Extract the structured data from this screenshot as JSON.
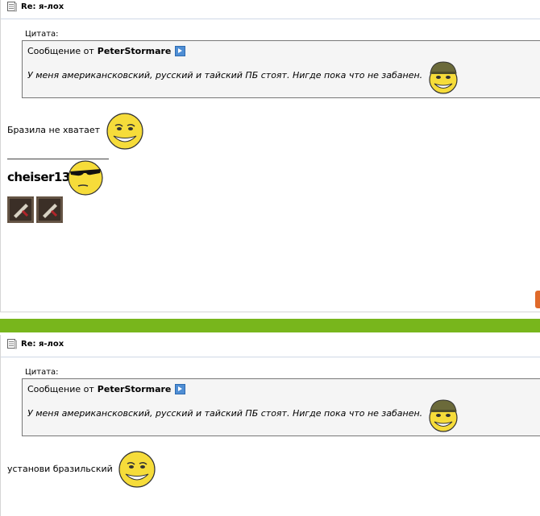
{
  "posts": [
    {
      "title": "Re: я-лох",
      "quote_label": "Цитата:",
      "quote_author_prefix": "Сообщение от",
      "quote_author": "PeterStormare",
      "quote_text": "У меня американскoвский, русский и тайский ПБ стоят. Нигде пока что не забанен.",
      "message": "Бразила не хватает",
      "signature": "cheiser13"
    },
    {
      "title": "Re: я-лох",
      "quote_label": "Цитата:",
      "quote_author_prefix": "Сообщение от",
      "quote_author": "PeterStormare",
      "quote_text": "У меня американскoвский, русский и тайский ПБ стоят. Нигде пока что не забанен.",
      "message": "установи бразильский"
    }
  ],
  "colors": {
    "separator": "#78b61c",
    "quote_bg": "#f5f5f5"
  }
}
